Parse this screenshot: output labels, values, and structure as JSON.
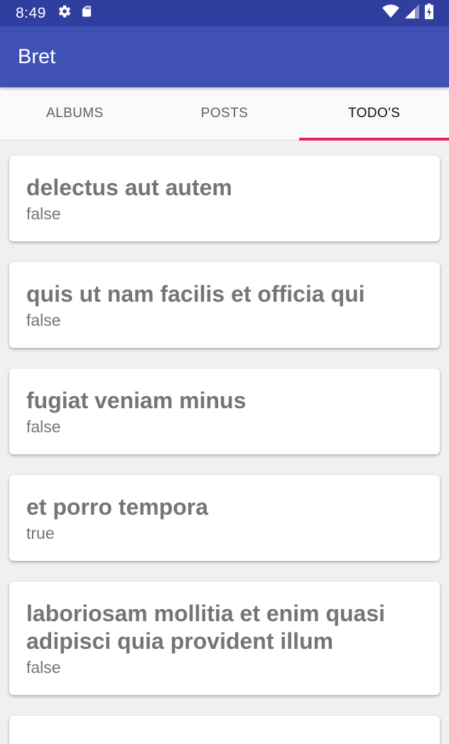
{
  "status_bar": {
    "time": "8:49",
    "icons_left": [
      "gear-icon",
      "sd-card-icon"
    ],
    "icons_right": [
      "wifi-icon",
      "signal-icon",
      "battery-icon"
    ]
  },
  "app_bar": {
    "title": "Bret"
  },
  "tabs": [
    {
      "label": "ALBUMS",
      "active": false
    },
    {
      "label": "POSTS",
      "active": false
    },
    {
      "label": "TODO'S",
      "active": true
    }
  ],
  "todos": [
    {
      "title": "delectus aut autem",
      "completed": "false"
    },
    {
      "title": "quis ut nam facilis et officia qui",
      "completed": "false"
    },
    {
      "title": "fugiat veniam minus",
      "completed": "false"
    },
    {
      "title": "et porro tempora",
      "completed": "true"
    },
    {
      "title": "laboriosam mollitia et enim quasi adipisci quia provident illum",
      "completed": "false"
    }
  ],
  "colors": {
    "status_bar": "#303f9f",
    "app_bar": "#3f51b5",
    "tab_indicator": "#e91e63"
  }
}
